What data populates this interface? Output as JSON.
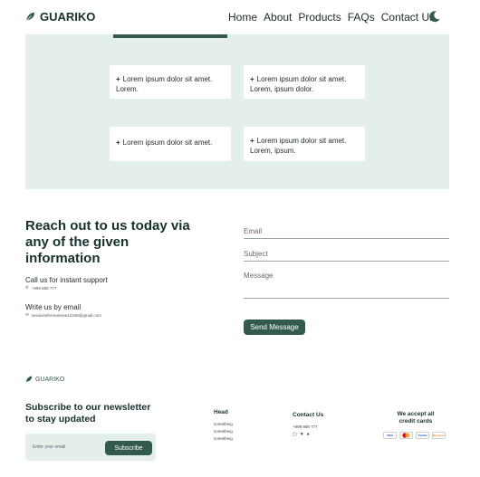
{
  "brand": {
    "name": "GUARIKO"
  },
  "nav": {
    "items": [
      "Home",
      "About",
      "Products",
      "FAQs",
      "Contact Us"
    ]
  },
  "faq": {
    "items": [
      {
        "text": "Lorem ipsum dolor sit amet. Lorem."
      },
      {
        "text": "Lorem ipsum dolor sit amet. Lorem, ipsum dolor."
      },
      {
        "text": "Lorem ipsum dolor sit amet."
      },
      {
        "text": "Lorem ipsum dolor sit amet. Lorem, ipsum."
      }
    ]
  },
  "contact": {
    "heading": "Reach out to us today via any of the given information",
    "call_label": "Call us for instant support",
    "phone": "+999 888 777",
    "email_label": "Write us by email",
    "email": "sessionsformansive12345@gmail.com",
    "form": {
      "email_placeholder": "Email",
      "subject_placeholder": "Subject",
      "message_placeholder": "Message",
      "send_label": "Send Message"
    }
  },
  "footer": {
    "brand": "GUARIKO",
    "newsletter_title": "Subscribe to our newsletter to stay updated",
    "newsletter_placeholder": "Enter your email",
    "subscribe_label": "Subscribe",
    "head": {
      "title": "Head",
      "items": [
        "something",
        "something",
        "something"
      ]
    },
    "contact": {
      "title": "Contact Us",
      "phone": "+999 888 777"
    },
    "payments": {
      "title": "We accept all credit cards",
      "cards": [
        "VISA",
        "Mastercard",
        "PayPal",
        "Discover"
      ]
    }
  },
  "colors": {
    "accent": "#335b4c",
    "panel": "#e5efe9",
    "text": "#15312c"
  }
}
